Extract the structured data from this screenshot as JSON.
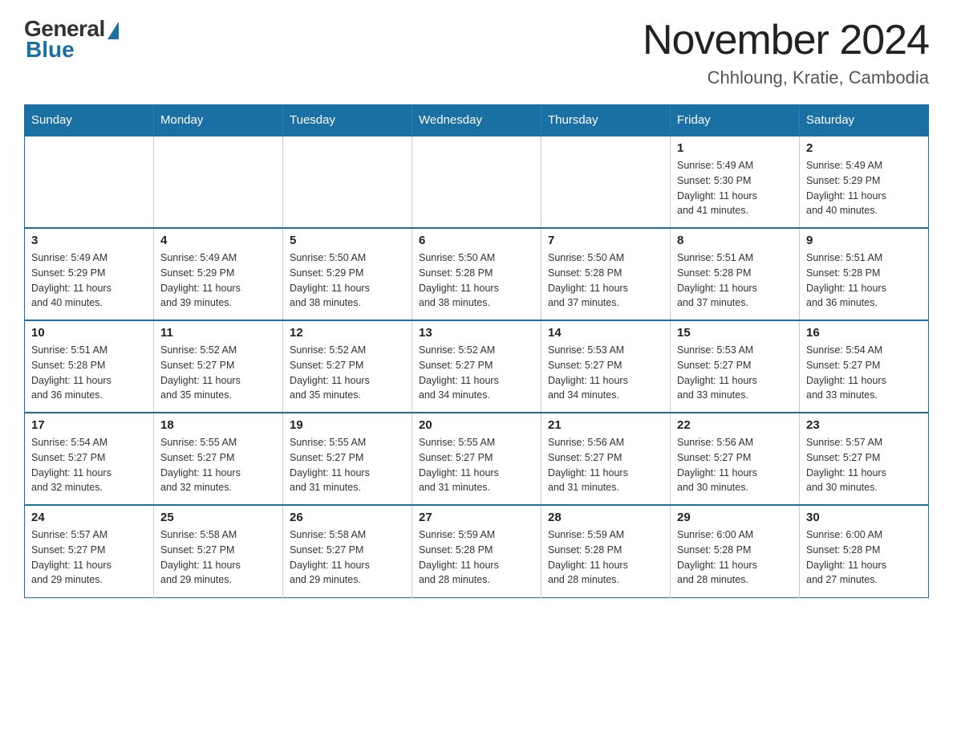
{
  "header": {
    "logo_general": "General",
    "logo_blue": "Blue",
    "main_title": "November 2024",
    "subtitle": "Chhloung, Kratie, Cambodia"
  },
  "calendar": {
    "days_of_week": [
      "Sunday",
      "Monday",
      "Tuesday",
      "Wednesday",
      "Thursday",
      "Friday",
      "Saturday"
    ],
    "weeks": [
      [
        {
          "day": "",
          "info": ""
        },
        {
          "day": "",
          "info": ""
        },
        {
          "day": "",
          "info": ""
        },
        {
          "day": "",
          "info": ""
        },
        {
          "day": "",
          "info": ""
        },
        {
          "day": "1",
          "info": "Sunrise: 5:49 AM\nSunset: 5:30 PM\nDaylight: 11 hours\nand 41 minutes."
        },
        {
          "day": "2",
          "info": "Sunrise: 5:49 AM\nSunset: 5:29 PM\nDaylight: 11 hours\nand 40 minutes."
        }
      ],
      [
        {
          "day": "3",
          "info": "Sunrise: 5:49 AM\nSunset: 5:29 PM\nDaylight: 11 hours\nand 40 minutes."
        },
        {
          "day": "4",
          "info": "Sunrise: 5:49 AM\nSunset: 5:29 PM\nDaylight: 11 hours\nand 39 minutes."
        },
        {
          "day": "5",
          "info": "Sunrise: 5:50 AM\nSunset: 5:29 PM\nDaylight: 11 hours\nand 38 minutes."
        },
        {
          "day": "6",
          "info": "Sunrise: 5:50 AM\nSunset: 5:28 PM\nDaylight: 11 hours\nand 38 minutes."
        },
        {
          "day": "7",
          "info": "Sunrise: 5:50 AM\nSunset: 5:28 PM\nDaylight: 11 hours\nand 37 minutes."
        },
        {
          "day": "8",
          "info": "Sunrise: 5:51 AM\nSunset: 5:28 PM\nDaylight: 11 hours\nand 37 minutes."
        },
        {
          "day": "9",
          "info": "Sunrise: 5:51 AM\nSunset: 5:28 PM\nDaylight: 11 hours\nand 36 minutes."
        }
      ],
      [
        {
          "day": "10",
          "info": "Sunrise: 5:51 AM\nSunset: 5:28 PM\nDaylight: 11 hours\nand 36 minutes."
        },
        {
          "day": "11",
          "info": "Sunrise: 5:52 AM\nSunset: 5:27 PM\nDaylight: 11 hours\nand 35 minutes."
        },
        {
          "day": "12",
          "info": "Sunrise: 5:52 AM\nSunset: 5:27 PM\nDaylight: 11 hours\nand 35 minutes."
        },
        {
          "day": "13",
          "info": "Sunrise: 5:52 AM\nSunset: 5:27 PM\nDaylight: 11 hours\nand 34 minutes."
        },
        {
          "day": "14",
          "info": "Sunrise: 5:53 AM\nSunset: 5:27 PM\nDaylight: 11 hours\nand 34 minutes."
        },
        {
          "day": "15",
          "info": "Sunrise: 5:53 AM\nSunset: 5:27 PM\nDaylight: 11 hours\nand 33 minutes."
        },
        {
          "day": "16",
          "info": "Sunrise: 5:54 AM\nSunset: 5:27 PM\nDaylight: 11 hours\nand 33 minutes."
        }
      ],
      [
        {
          "day": "17",
          "info": "Sunrise: 5:54 AM\nSunset: 5:27 PM\nDaylight: 11 hours\nand 32 minutes."
        },
        {
          "day": "18",
          "info": "Sunrise: 5:55 AM\nSunset: 5:27 PM\nDaylight: 11 hours\nand 32 minutes."
        },
        {
          "day": "19",
          "info": "Sunrise: 5:55 AM\nSunset: 5:27 PM\nDaylight: 11 hours\nand 31 minutes."
        },
        {
          "day": "20",
          "info": "Sunrise: 5:55 AM\nSunset: 5:27 PM\nDaylight: 11 hours\nand 31 minutes."
        },
        {
          "day": "21",
          "info": "Sunrise: 5:56 AM\nSunset: 5:27 PM\nDaylight: 11 hours\nand 31 minutes."
        },
        {
          "day": "22",
          "info": "Sunrise: 5:56 AM\nSunset: 5:27 PM\nDaylight: 11 hours\nand 30 minutes."
        },
        {
          "day": "23",
          "info": "Sunrise: 5:57 AM\nSunset: 5:27 PM\nDaylight: 11 hours\nand 30 minutes."
        }
      ],
      [
        {
          "day": "24",
          "info": "Sunrise: 5:57 AM\nSunset: 5:27 PM\nDaylight: 11 hours\nand 29 minutes."
        },
        {
          "day": "25",
          "info": "Sunrise: 5:58 AM\nSunset: 5:27 PM\nDaylight: 11 hours\nand 29 minutes."
        },
        {
          "day": "26",
          "info": "Sunrise: 5:58 AM\nSunset: 5:27 PM\nDaylight: 11 hours\nand 29 minutes."
        },
        {
          "day": "27",
          "info": "Sunrise: 5:59 AM\nSunset: 5:28 PM\nDaylight: 11 hours\nand 28 minutes."
        },
        {
          "day": "28",
          "info": "Sunrise: 5:59 AM\nSunset: 5:28 PM\nDaylight: 11 hours\nand 28 minutes."
        },
        {
          "day": "29",
          "info": "Sunrise: 6:00 AM\nSunset: 5:28 PM\nDaylight: 11 hours\nand 28 minutes."
        },
        {
          "day": "30",
          "info": "Sunrise: 6:00 AM\nSunset: 5:28 PM\nDaylight: 11 hours\nand 27 minutes."
        }
      ]
    ]
  }
}
